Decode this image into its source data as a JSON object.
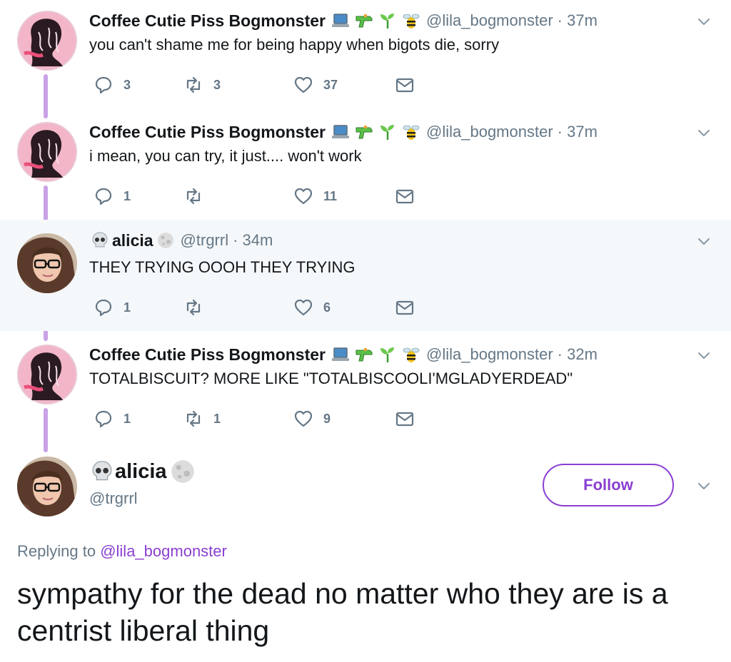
{
  "tweets": [
    {
      "name": "Coffee Cutie Piss Bogmonster",
      "handle": "@lila_bogmonster",
      "time": "· 37m",
      "text": "you can't shame me for being happy when bigots die, sorry",
      "reply_count": "3",
      "retweet_count": "3",
      "like_count": "37",
      "emoji_icons": [
        "laptop-icon",
        "water-gun-icon",
        "seedling-icon",
        "bee-icon"
      ]
    },
    {
      "name": "Coffee Cutie Piss Bogmonster",
      "handle": "@lila_bogmonster",
      "time": "· 37m",
      "text": "i mean, you can try, it just.... won't work",
      "reply_count": "1",
      "retweet_count": "",
      "like_count": "11",
      "emoji_icons": [
        "laptop-icon",
        "water-gun-icon",
        "seedling-icon",
        "bee-icon"
      ]
    },
    {
      "name": "alicia",
      "handle": "@trgrrl",
      "time": "· 34m",
      "text": "THEY TRYING OOOH THEY TRYING",
      "reply_count": "1",
      "retweet_count": "",
      "like_count": "6",
      "emoji_icons": [
        "skull-icon",
        "moon-icon"
      ]
    },
    {
      "name": "Coffee Cutie Piss Bogmonster",
      "handle": "@lila_bogmonster",
      "time": "· 32m",
      "text": "TOTALBISCUIT? MORE LIKE \"TOTALBISCOOLI'MGLADYERDEAD\"",
      "reply_count": "1",
      "retweet_count": "1",
      "like_count": "9",
      "emoji_icons": [
        "laptop-icon",
        "water-gun-icon",
        "seedling-icon",
        "bee-icon"
      ]
    }
  ],
  "main_tweet": {
    "name": "alicia",
    "handle": "@trgrrl",
    "follow_label": "Follow",
    "replying_prefix": "Replying to",
    "replying_handle": "@lila_bogmonster",
    "text": "sympathy for the dead no matter who they are is a centrist liberal thing"
  },
  "colors": {
    "accent": "#8a3fd1",
    "thread_line": "#c9a2e6",
    "muted": "#657786",
    "highlight_bg": "#f5f8fa"
  }
}
